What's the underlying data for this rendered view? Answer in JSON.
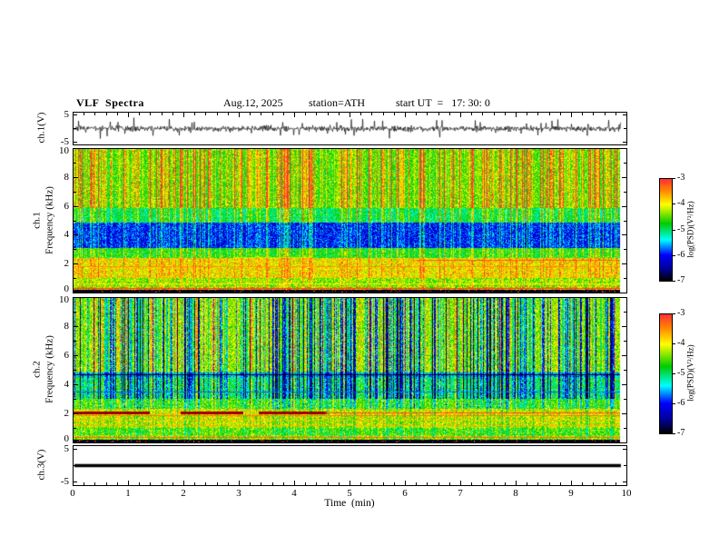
{
  "page": {
    "background": "#ffffff",
    "frame_color": "#000000"
  },
  "header": {
    "title": "VLF  Spectra",
    "date": "Aug.12, 2025",
    "station": "station=ATH",
    "start_ut": "start UT  =   17: 30: 0"
  },
  "x_axis": {
    "label": "Time  (min)",
    "min": 0,
    "max": 10,
    "major_ticks": [
      0,
      1,
      2,
      3,
      4,
      5,
      6,
      7,
      8,
      9,
      10
    ],
    "minor_step": 0.2
  },
  "panels": {
    "wave1": {
      "ylabel": "ch.1(V)",
      "ylim": [
        -5,
        5
      ],
      "yticks": [
        5,
        -5
      ]
    },
    "spec1": {
      "channel": "ch.1",
      "ylabel": "Frequency (kHz)",
      "ylim": [
        0,
        10
      ],
      "yticks": [
        10,
        8,
        6,
        4,
        2,
        0
      ]
    },
    "spec2": {
      "channel": "ch.2",
      "ylabel": "Frequency (kHz)",
      "ylim": [
        0,
        10
      ],
      "yticks": [
        10,
        8,
        6,
        4,
        2,
        0
      ]
    },
    "wave3": {
      "ylabel": "ch.3(V)",
      "ylim": [
        -5,
        5
      ],
      "yticks": [
        5,
        -5
      ]
    }
  },
  "colorbar": {
    "label": "log(PSD)(V²/Hz)",
    "min": -7,
    "max": -3,
    "ticks": [
      -3,
      -4,
      -5,
      -6,
      -7
    ],
    "over": "#990000",
    "stops": [
      {
        "v": -7.0,
        "c": "#000000"
      },
      {
        "v": -6.55,
        "c": "#000099"
      },
      {
        "v": -6.0,
        "c": "#0000ff"
      },
      {
        "v": -5.4,
        "c": "#00ffff"
      },
      {
        "v": -4.75,
        "c": "#00cc00"
      },
      {
        "v": -4.0,
        "c": "#ffff00"
      },
      {
        "v": -3.45,
        "c": "#ff8800"
      },
      {
        "v": -3.0,
        "c": "#ff3333"
      }
    ]
  },
  "chart_data": [
    {
      "type": "line",
      "title": "ch.1(V) waveform",
      "xlabel": "Time (min)",
      "x_range": [
        0,
        9.9
      ],
      "ylabel": "ch.1(V)",
      "ylim": [
        -5,
        5
      ],
      "summary": "Zero-mean broadband VLF noise, RMS about 1 V, with dense impulsive sferic spikes reaching roughly +/-4 V throughout the 10-minute record",
      "seed": 7,
      "t_end": 9.9,
      "noise": 0.5,
      "spike_prob": 0.045,
      "spike_min": 1.0,
      "spike_span": 2.6
    },
    {
      "type": "heatmap",
      "title": "ch.1 spectrogram",
      "xlabel": "Time (min)",
      "x_range": [
        0,
        9.9
      ],
      "ylabel": "Frequency (kHz)",
      "ylim": [
        0,
        10
      ],
      "zlabel": "log(PSD)(V²/Hz)",
      "zlim": [
        -7,
        -3
      ],
      "summary": "Green background near -4.7 above 6 kHz crossed by dense vertical sferic streaks reaching -3 (red); quiet blue band near -6.2 between 3.1 and 4.9 kHz; yellow-green enhancement near -4 from 1 to 2.4 kHz; narrow horizontal lines near 1.8 kHz (full record) and 2.2 kHz (from ~6.2 min); black strip at -7 below 0.13 kHz",
      "seed": 21,
      "t_end": 9.9,
      "frequency_bands": [
        {
          "f0": 0.0,
          "f1": 0.13,
          "base": -7.0,
          "noise": 0.25,
          "streak": 0.0
        },
        {
          "f0": 0.13,
          "f1": 0.32,
          "base": -4.0,
          "noise": 0.85,
          "streak": 0.25
        },
        {
          "f0": 0.32,
          "f1": 1.0,
          "base": -4.5,
          "noise": 0.5,
          "streak": 0.35
        },
        {
          "f0": 1.0,
          "f1": 2.4,
          "base": -4.05,
          "noise": 0.5,
          "streak": 0.35
        },
        {
          "f0": 2.4,
          "f1": 3.1,
          "base": -4.9,
          "noise": 0.45,
          "streak": 0.5
        },
        {
          "f0": 3.1,
          "f1": 4.9,
          "base": -6.15,
          "noise": 0.5,
          "streak": 0.45
        },
        {
          "f0": 4.9,
          "f1": 5.9,
          "base": -5.15,
          "noise": 0.4,
          "streak": 0.7
        },
        {
          "f0": 5.9,
          "f1": 10.01,
          "base": -4.7,
          "noise": 0.45,
          "streak": 1.0
        }
      ],
      "impulsive_streaks": {
        "base": 0.35,
        "modes": [
          {
            "p": 0.16,
            "lo": 1.3,
            "hi": 2.6
          },
          {
            "p": 0.3,
            "lo": 0.5,
            "hi": 1.3
          }
        ]
      },
      "narrowband_lines": [
        {
          "f": 2.2,
          "t0": 6.2,
          "t1": 9.9,
          "amp": 0.85,
          "w": 1
        },
        {
          "f": 1.8,
          "t0": 0.0,
          "t1": 9.9,
          "amp": 0.55,
          "w": 1
        },
        {
          "f": 2.45,
          "t0": 2.9,
          "t1": 4.3,
          "amp": 0.7,
          "w": 1
        },
        {
          "f": 0.55,
          "t0": 0.0,
          "t1": 9.9,
          "amp": 0.6,
          "w": 1
        },
        {
          "f": 0.25,
          "t0": 0.0,
          "t1": 9.9,
          "amp": 1.0,
          "w": 1
        }
      ],
      "low_band_speckle": {
        "fmax": 0.13,
        "p": 0.05,
        "v": -3.2
      }
    },
    {
      "type": "heatmap",
      "title": "ch.2 spectrogram",
      "xlabel": "Time (min)",
      "x_range": [
        0,
        9.9
      ],
      "ylabel": "Frequency (kHz)",
      "ylim": [
        0,
        10
      ],
      "zlabel": "log(PSD)(V²/Hz)",
      "zlim": [
        -7,
        -3
      ],
      "summary": "Yellow-green background near -4.45 above 4.9 kHz crossed by dense blue vertical streaks; dark narrow line near 4.7 kHz; green-cyan band 3-4.5 kHz; strong yellow band 1-2.3 kHz with intense dark-red narrowband segments near 2.05 kHz (0-1.35, 1.95-3.05, 3.35-4.55 min) and weaker lines at 1.85, 1.5, 1.15 and 0.3 kHz; black strip at -7 below 0.13 kHz",
      "seed": 33,
      "t_end": 9.9,
      "frequency_bands": [
        {
          "f0": 0.0,
          "f1": 0.13,
          "base": -7.0,
          "noise": 0.25,
          "streak": 0.0
        },
        {
          "f0": 0.13,
          "f1": 0.5,
          "base": -4.3,
          "noise": 0.75,
          "streak": 0.2
        },
        {
          "f0": 0.5,
          "f1": 1.0,
          "base": -4.5,
          "noise": 0.5,
          "streak": 0.25
        },
        {
          "f0": 1.0,
          "f1": 1.7,
          "base": -4.15,
          "noise": 0.5,
          "streak": 0.25
        },
        {
          "f0": 1.7,
          "f1": 2.3,
          "base": -4.0,
          "noise": 0.55,
          "streak": 0.25
        },
        {
          "f0": 2.3,
          "f1": 3.0,
          "base": -4.55,
          "noise": 0.5,
          "streak": 0.45
        },
        {
          "f0": 3.0,
          "f1": 4.5,
          "base": -5.05,
          "noise": 0.55,
          "streak": 0.8
        },
        {
          "f0": 4.5,
          "f1": 4.85,
          "base": -5.6,
          "noise": 0.4,
          "streak": 0.5
        },
        {
          "f0": 4.85,
          "f1": 10.01,
          "base": -4.45,
          "noise": 0.5,
          "streak": 1.0
        }
      ],
      "impulsive_streaks": {
        "base": 0.3,
        "modes": [
          {
            "p": 0.26,
            "lo": -2.4,
            "hi": -1.1
          },
          {
            "p": 0.14,
            "lo": 0.5,
            "hi": 1.1
          },
          {
            "p": 0.2,
            "lo": -1.0,
            "hi": -0.3
          }
        ]
      },
      "narrowband_lines": [
        {
          "f": 4.7,
          "t0": 0.0,
          "t1": 9.9,
          "amp": -1.3,
          "w": 1
        },
        {
          "f": 2.05,
          "t0": 0.0,
          "t1": 1.35,
          "amp": 3.2,
          "w": 2
        },
        {
          "f": 2.05,
          "t0": 1.95,
          "t1": 3.05,
          "amp": 3.2,
          "w": 2
        },
        {
          "f": 2.05,
          "t0": 3.35,
          "t1": 4.55,
          "amp": 3.2,
          "w": 2
        },
        {
          "f": 2.05,
          "t0": 4.55,
          "t1": 9.9,
          "amp": 0.85,
          "w": 1
        },
        {
          "f": 1.85,
          "t0": 0.0,
          "t1": 9.9,
          "amp": 0.6,
          "w": 1
        },
        {
          "f": 1.5,
          "t0": 0.0,
          "t1": 9.9,
          "amp": 0.5,
          "w": 1
        },
        {
          "f": 1.15,
          "t0": 0.0,
          "t1": 9.9,
          "amp": 0.5,
          "w": 1
        },
        {
          "f": 3.45,
          "t0": 0.0,
          "t1": 9.9,
          "amp": -0.7,
          "w": 1
        },
        {
          "f": 0.3,
          "t0": 0.0,
          "t1": 9.9,
          "amp": 1.0,
          "w": 1
        }
      ],
      "low_band_speckle": {
        "fmax": 0.13,
        "p": 0.05,
        "v": -3.2
      }
    },
    {
      "type": "line",
      "title": "ch.3(V) waveform",
      "xlabel": "Time (min)",
      "x_range": [
        0,
        9.9
      ],
      "ylabel": "ch.3(V)",
      "ylim": [
        -5,
        5
      ],
      "summary": "Flat signal: constant 0 V for the entire record (thick black line)",
      "y_constant": 0,
      "thickness": 3.5,
      "t_end": 9.9
    }
  ]
}
